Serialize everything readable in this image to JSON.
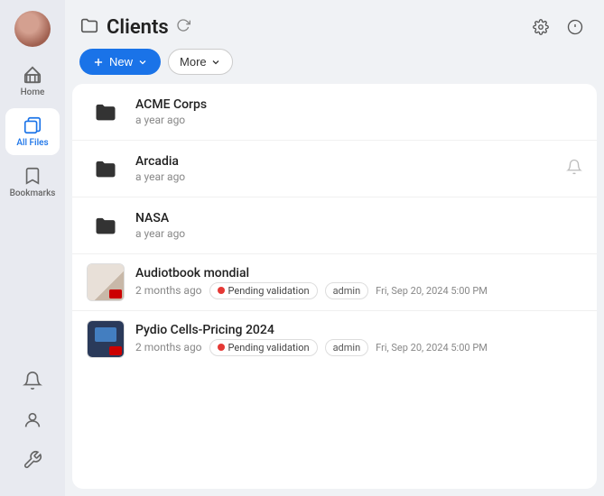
{
  "sidebar": {
    "items": [
      {
        "label": "Home",
        "icon": "home-icon",
        "active": false
      },
      {
        "label": "All Files",
        "icon": "files-icon",
        "active": true
      }
    ],
    "bookmarks": {
      "label": "Bookmarks",
      "icon": "bookmark-icon"
    },
    "bottom": [
      {
        "label": "bell-icon"
      },
      {
        "label": "person-icon"
      },
      {
        "label": "settings-tools-icon"
      }
    ]
  },
  "header": {
    "folder_icon": "folder-icon",
    "title": "Clients",
    "refresh_icon": "refresh-icon",
    "gear_icon": "gear-icon",
    "info_icon": "info-icon"
  },
  "toolbar": {
    "new_label": "New",
    "more_label": "More"
  },
  "files": [
    {
      "id": "acme",
      "name": "ACME Corps",
      "date": "a year ago",
      "type": "folder",
      "tags": [],
      "hasNotification": false
    },
    {
      "id": "arcadia",
      "name": "Arcadia",
      "date": "a year ago",
      "type": "folder",
      "tags": [],
      "hasNotification": true
    },
    {
      "id": "nasa",
      "name": "NASA",
      "date": "a year ago",
      "type": "folder",
      "tags": [],
      "hasNotification": false
    },
    {
      "id": "audiotbook",
      "name": "Audiotbook mondial",
      "date": "2 months ago",
      "type": "document",
      "tags": [
        {
          "type": "status",
          "label": "Pending validation",
          "color": "#e53935"
        },
        {
          "type": "person",
          "label": "admin"
        },
        {
          "type": "datetime",
          "label": "Fri, Sep 20, 2024 5:00 PM"
        }
      ],
      "hasNotification": false
    },
    {
      "id": "pydio",
      "name": "Pydio Cells-Pricing 2024",
      "date": "2 months ago",
      "type": "document",
      "tags": [
        {
          "type": "status",
          "label": "Pending validation",
          "color": "#e53935"
        },
        {
          "type": "person",
          "label": "admin"
        },
        {
          "type": "datetime",
          "label": "Fri, Sep 20, 2024 5:00 PM"
        }
      ],
      "hasNotification": false
    }
  ]
}
